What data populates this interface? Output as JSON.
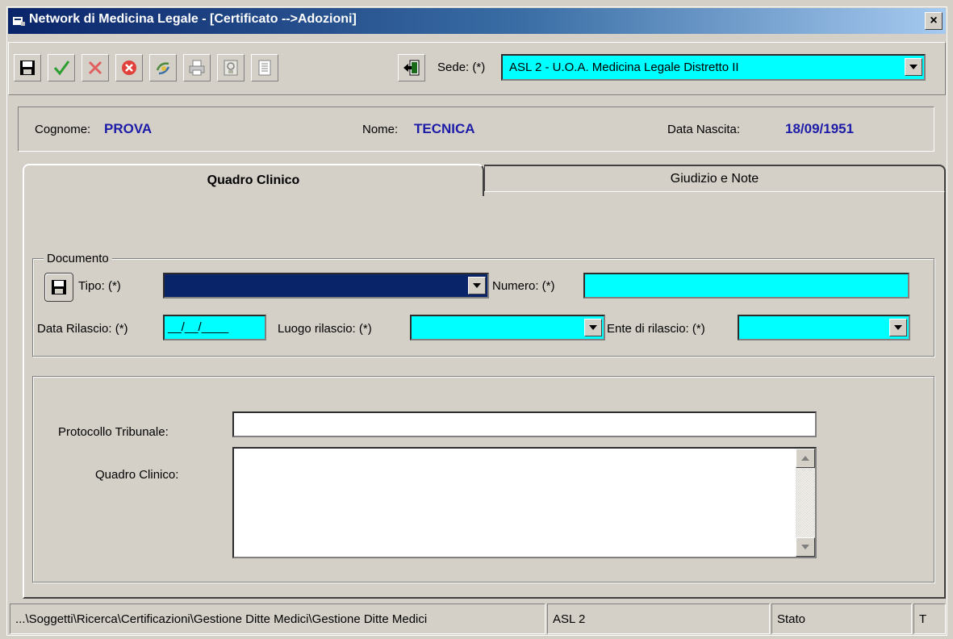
{
  "window": {
    "title": "Network di Medicina Legale - [Certificato -->Adozioni]",
    "close_label": "×"
  },
  "toolbar": {
    "buttons": [
      {
        "name": "save-icon",
        "color": "#000000"
      },
      {
        "name": "check-icon",
        "color": "#2e9e2e"
      },
      {
        "name": "cancel-x-icon",
        "color": "#e06060"
      },
      {
        "name": "delete-circle-icon",
        "color": "#e0413a"
      },
      {
        "name": "refresh-icon",
        "color": "#4a8a3a"
      },
      {
        "name": "print-icon",
        "color": "#808080"
      },
      {
        "name": "certificate-icon",
        "color": "#808080"
      },
      {
        "name": "document-icon",
        "color": "#808080"
      },
      {
        "name": "exit-icon",
        "color": "#1a6a1a"
      }
    ],
    "sede_label": "Sede: (*)",
    "sede_value": "ASL 2 - U.O.A. Medicina Legale Distretto II"
  },
  "patient": {
    "cognome_label": "Cognome:",
    "cognome_value": "PROVA",
    "nome_label": "Nome:",
    "nome_value": "TECNICA",
    "nascita_label": "Data Nascita:",
    "nascita_value": "18/09/1951"
  },
  "tabs": [
    {
      "label": "Quadro Clinico",
      "active": true
    },
    {
      "label": "Giudizio e Note",
      "active": false
    }
  ],
  "documento": {
    "legend": "Documento",
    "tipo_label": "Tipo: (*)",
    "tipo_value": "",
    "numero_label": "Numero: (*)",
    "numero_value": "",
    "data_rilascio_label": "Data Rilascio: (*)",
    "data_rilascio_value": "__/__/____",
    "luogo_label": "Luogo rilascio: (*)",
    "luogo_value": "",
    "ente_label": "Ente di rilascio: (*)",
    "ente_value": ""
  },
  "dettagli": {
    "protocollo_label": "Protocollo Tribunale:",
    "protocollo_value": "",
    "quadro_label": "Quadro Clinico:",
    "quadro_value": ""
  },
  "status_bar": {
    "path": "...\\Soggetti\\Ricerca\\Certificazioni\\Gestione Ditte Medici\\Gestione Ditte Medici",
    "asl": "ASL 2",
    "blank": "",
    "stato": "Stato",
    "mode": "T"
  },
  "colors": {
    "required_field": "#00ffff",
    "selected_field": "#0a246a",
    "patient_value": "#1c1ca8"
  }
}
